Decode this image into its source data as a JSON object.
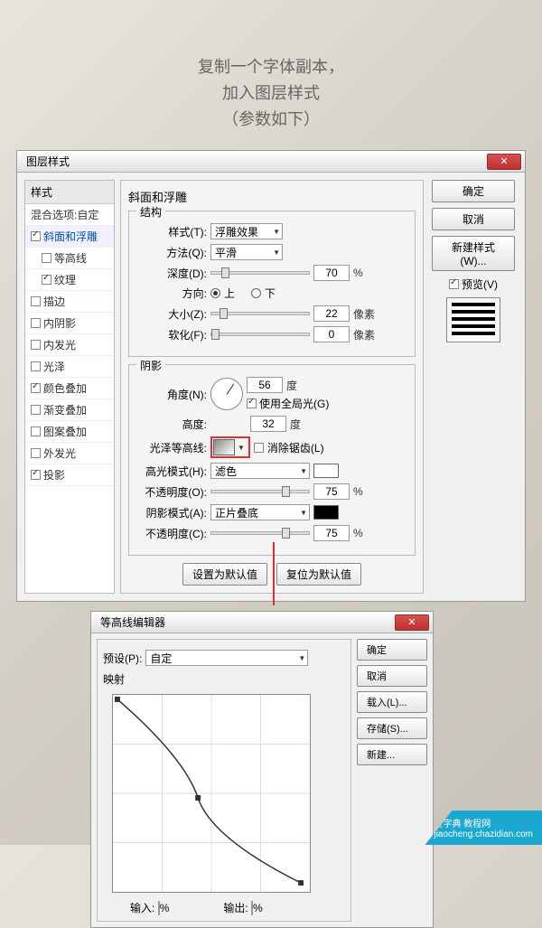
{
  "instruction": {
    "line1": "复制一个字体副本，",
    "line2": "加入图层样式",
    "line3": "（参数如下）"
  },
  "dialog1": {
    "title": "图层样式",
    "close": "✕",
    "styles_header": "样式",
    "blend_options": "混合选项:自定",
    "items": [
      {
        "label": "斜面和浮雕",
        "checked": true,
        "selected": true
      },
      {
        "label": "等高线",
        "checked": false,
        "indent": true
      },
      {
        "label": "纹理",
        "checked": true,
        "indent": true
      },
      {
        "label": "描边",
        "checked": false
      },
      {
        "label": "内阴影",
        "checked": false
      },
      {
        "label": "内发光",
        "checked": false
      },
      {
        "label": "光泽",
        "checked": false
      },
      {
        "label": "颜色叠加",
        "checked": true
      },
      {
        "label": "渐变叠加",
        "checked": false
      },
      {
        "label": "图案叠加",
        "checked": false
      },
      {
        "label": "外发光",
        "checked": false
      },
      {
        "label": "投影",
        "checked": true
      }
    ],
    "bevel": {
      "title": "斜面和浮雕",
      "structure_title": "结构",
      "style_label": "样式(T):",
      "style_value": "浮雕效果",
      "technique_label": "方法(Q):",
      "technique_value": "平滑",
      "depth_label": "深度(D):",
      "depth_value": "70",
      "percent": "%",
      "direction_label": "方向:",
      "direction_up": "上",
      "direction_down": "下",
      "size_label": "大小(Z):",
      "size_value": "22",
      "pixels": "像素",
      "soften_label": "软化(F):",
      "soften_value": "0",
      "shading_title": "阴影",
      "angle_label": "角度(N):",
      "angle_value": "56",
      "degree": "度",
      "global_light": "使用全局光(G)",
      "altitude_label": "高度:",
      "altitude_value": "32",
      "gloss_label": "光泽等高线:",
      "antialias": "消除锯齿(L)",
      "highlight_mode_label": "高光模式(H):",
      "highlight_mode_value": "滤色",
      "opacity_label": "不透明度(O):",
      "highlight_opacity": "75",
      "shadow_mode_label": "阴影模式(A):",
      "shadow_mode_value": "正片叠底",
      "shadow_opacity_label": "不透明度(C):",
      "shadow_opacity": "75",
      "set_default": "设置为默认值",
      "reset_default": "复位为默认值"
    },
    "buttons": {
      "ok": "确定",
      "cancel": "取消",
      "new_style": "新建样式(W)...",
      "preview": "预览(V)"
    }
  },
  "dialog2": {
    "title": "等高线编辑器",
    "preset_label": "预设(P):",
    "preset_value": "自定",
    "mapping": "映射",
    "input_label": "输入:",
    "output_label": "输出:",
    "percent": "%",
    "buttons": {
      "ok": "确定",
      "cancel": "取消",
      "load": "载入(L)...",
      "save": "存储(S)...",
      "new": "新建..."
    }
  },
  "watermark": {
    "line1": "查字典 教程网",
    "line2": "jiaocheng.chazidian.com"
  }
}
